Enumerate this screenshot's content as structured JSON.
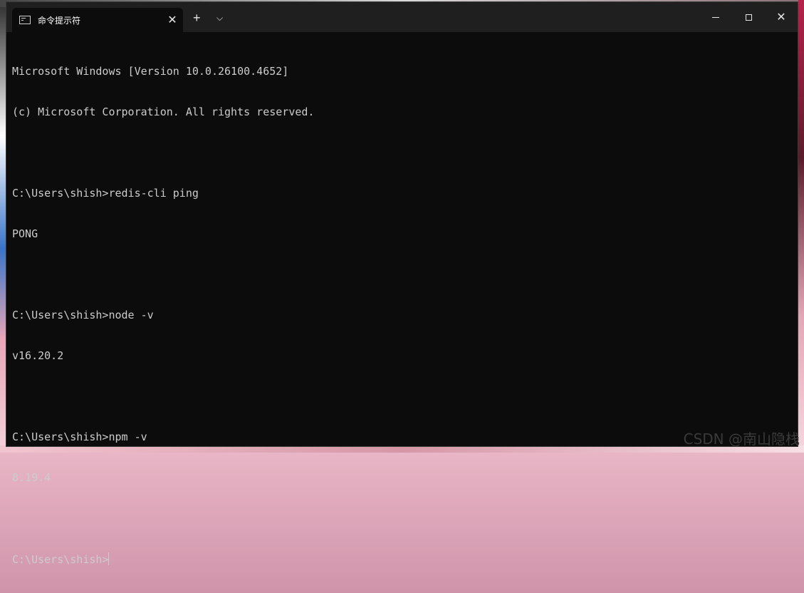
{
  "window": {
    "tab_title": "命令提示符",
    "tab_close": "✕",
    "new_tab": "+",
    "dropdown": "⌵",
    "close": "✕"
  },
  "console": {
    "lines": [
      "Microsoft Windows [Version 10.0.26100.4652]",
      "(c) Microsoft Corporation. All rights reserved.",
      "",
      "C:\\Users\\shish>redis-cli ping",
      "PONG",
      "",
      "C:\\Users\\shish>node -v",
      "v16.20.2",
      "",
      "C:\\Users\\shish>npm -v",
      "8.19.4",
      ""
    ],
    "prompt": "C:\\Users\\shish>"
  },
  "watermark": "CSDN @南山隐栈",
  "colors": {
    "console_bg": "#0c0c0c",
    "titlebar_bg": "#1f1f1f",
    "text": "#cccccc"
  },
  "icons": [
    "cmd-icon",
    "close-icon",
    "plus-icon",
    "chevron-down-icon",
    "minimize-icon",
    "maximize-icon"
  ]
}
